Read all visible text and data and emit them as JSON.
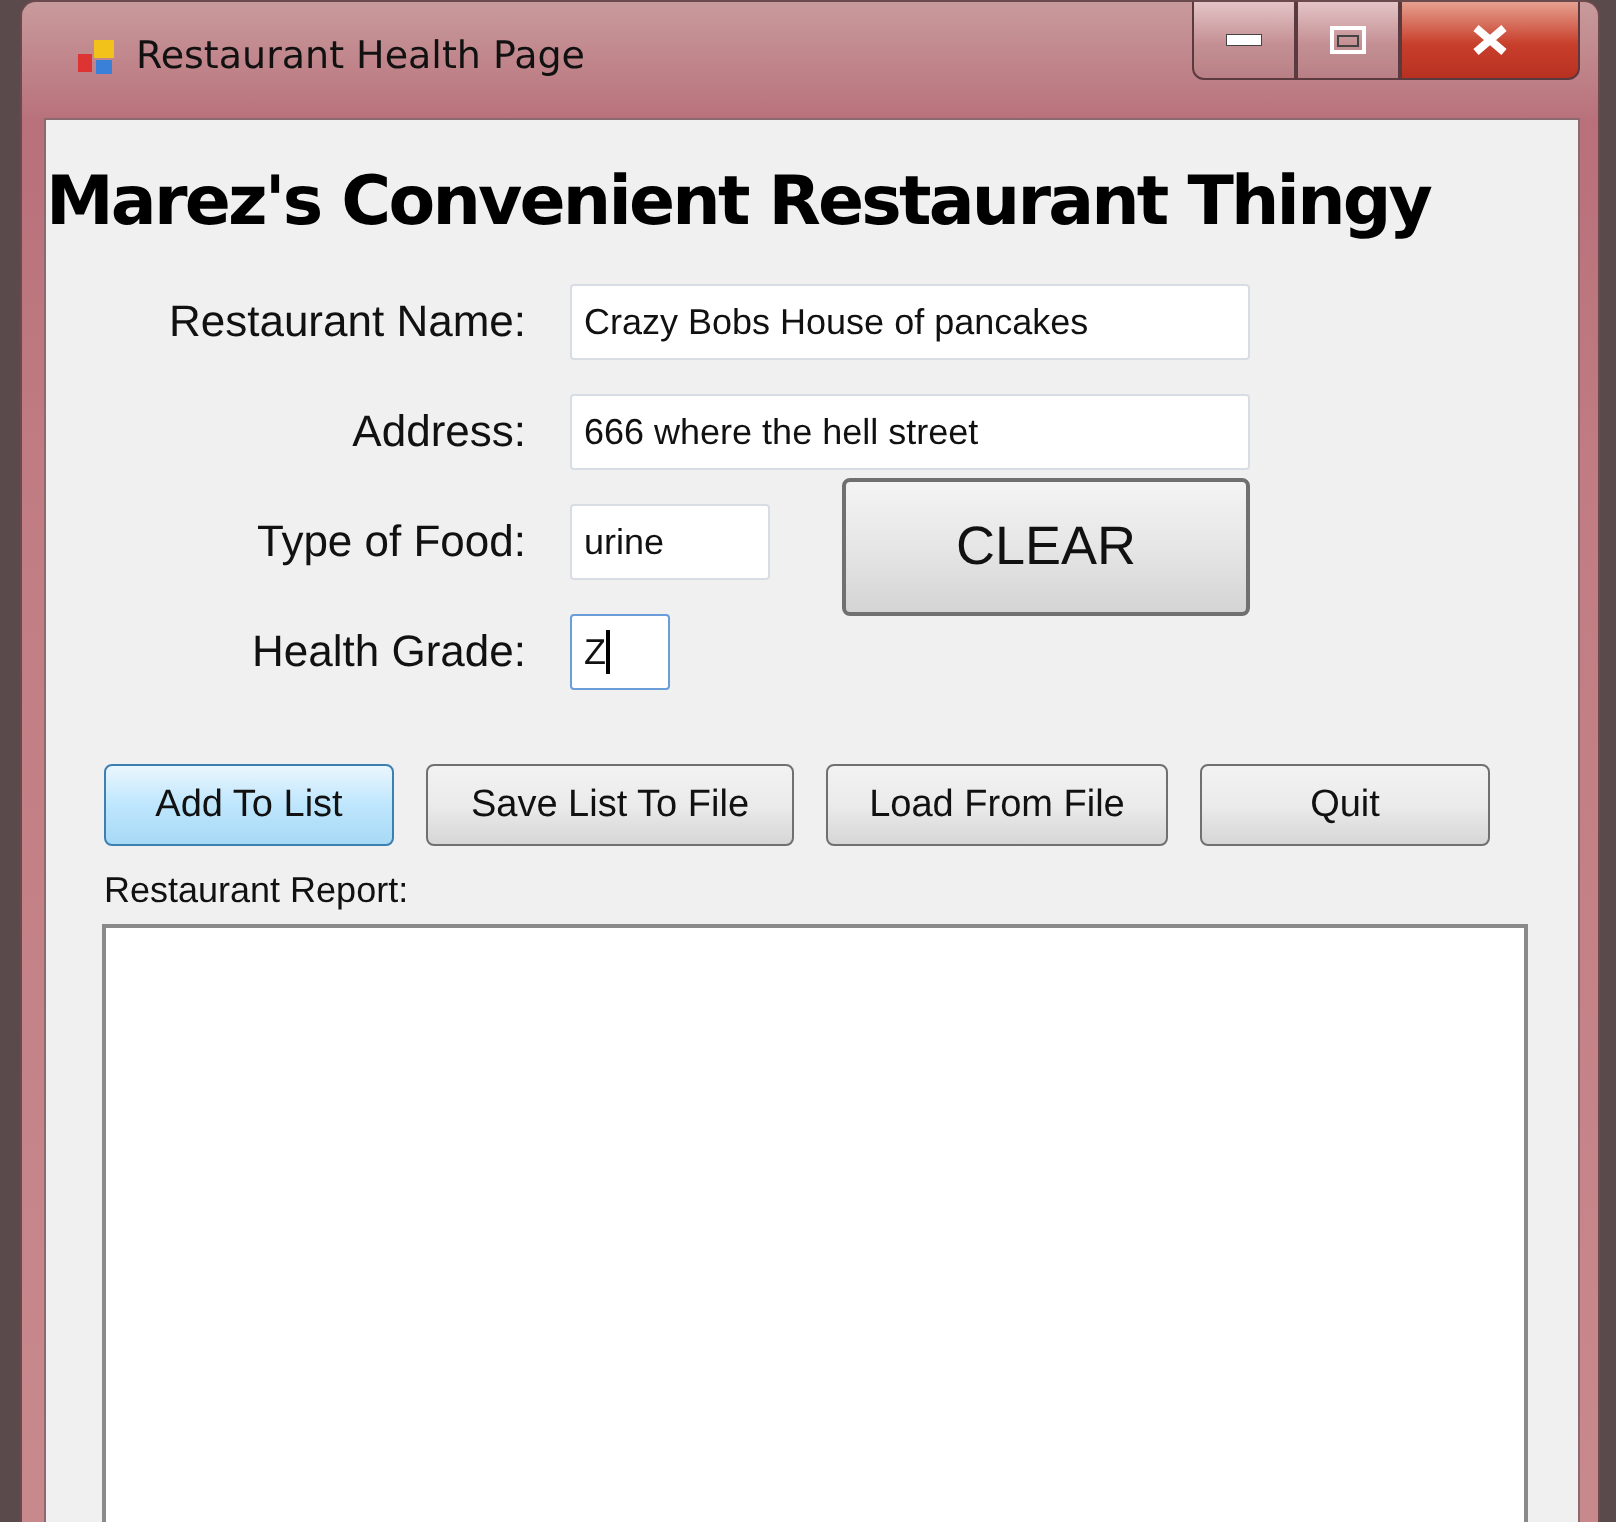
{
  "window": {
    "title": "Restaurant Health Page"
  },
  "heading": "Marez's Convenient Restaurant Thingy",
  "fields": [
    {
      "label": "Restaurant Name:",
      "value": "Crazy Bobs House of pancakes",
      "focused": false
    },
    {
      "label": "Address:",
      "value": "666 where the hell street",
      "focused": false
    },
    {
      "label": "Type of Food:",
      "value": "urine",
      "focused": false
    },
    {
      "label": "Health Grade:",
      "value": "Z",
      "focused": true
    }
  ],
  "clear_button": "CLEAR",
  "buttons": [
    {
      "label": "Add To List",
      "highlighted": true
    },
    {
      "label": "Save List To File",
      "highlighted": false
    },
    {
      "label": "Load From File",
      "highlighted": false
    },
    {
      "label": "Quit",
      "highlighted": false
    }
  ],
  "report": {
    "label": "Restaurant Report:"
  }
}
